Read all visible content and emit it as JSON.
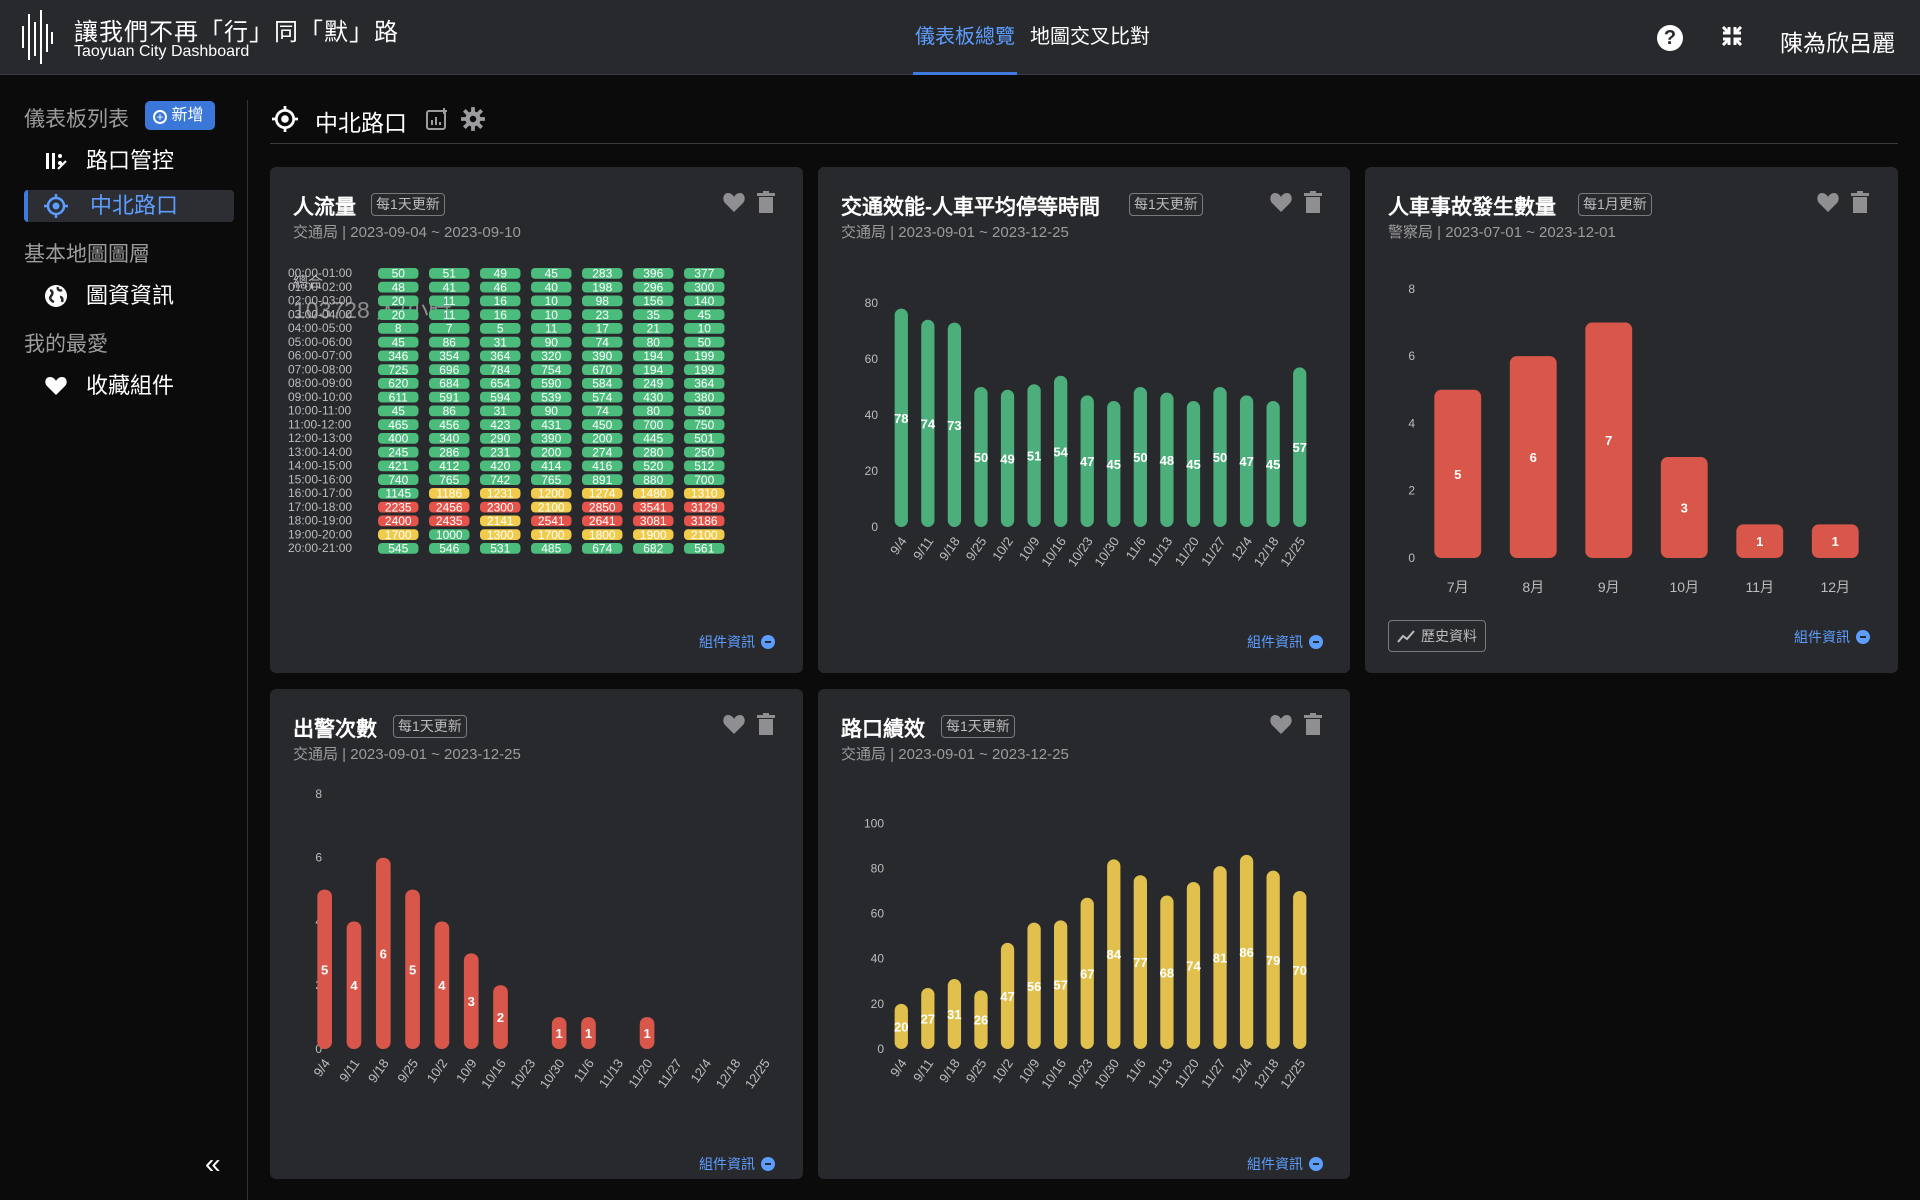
{
  "app": {
    "title": "讓我們不再「行」同「默」路",
    "subtitle": "Taoyuan City Dashboard",
    "nav": [
      "儀表板總覽",
      "地圖交叉比對"
    ],
    "user": "陳為欣呂麗",
    "icons": {
      "logo": "city-logo-icon",
      "help": "help-icon",
      "collapse": "compress-icon"
    },
    "accent": "#3f7ae0"
  },
  "sidebar": {
    "sections": {
      "dashboards": "儀表板列表",
      "basemap": "基本地圖圖層",
      "favorites": "我的最愛"
    },
    "add_button": "新增",
    "items": [
      {
        "label": "路口管控",
        "icon": "traffic-control-icon"
      },
      {
        "label": "中北路口",
        "icon": "target-icon",
        "active": true
      },
      {
        "label": "圖資資訊",
        "icon": "globe-icon"
      },
      {
        "label": "收藏組件",
        "icon": "heart-icon"
      }
    ],
    "collapse_label": "«"
  },
  "main": {
    "title": "中北路口"
  },
  "info_label": "組件資訊",
  "cards": {
    "pedestrian": {
      "title": "人流量",
      "badge": "每1天更新",
      "source": "交通局 | 2023-09-04 ~ 2023-09-10",
      "total_label": "總合",
      "total_value": "103728 人/小時"
    },
    "waiting": {
      "title": "交通效能-人車平均停等時間",
      "badge": "每1天更新",
      "source": "交通局 | 2023-09-01 ~ 2023-12-25"
    },
    "accidents": {
      "title": "人車事故發生數量",
      "badge": "每1月更新",
      "source": "警察局 | 2023-07-01 ~ 2023-12-01",
      "history_button": "歷史資料"
    },
    "dispatch": {
      "title": "出警次數",
      "badge": "每1天更新",
      "source": "交通局 | 2023-09-01 ~ 2023-12-25"
    },
    "performance": {
      "title": "路口績效",
      "badge": "每1天更新",
      "source": "交通局 | 2023-09-01 ~ 2023-12-25"
    }
  },
  "chart_data": [
    {
      "id": "pedestrian-heatmap",
      "type": "heatmap",
      "rows": [
        "00:00-01:00",
        "01:00-02:00",
        "02:00-03:00",
        "03:00-04:00",
        "04:00-05:00",
        "05:00-06:00",
        "06:00-07:00",
        "07:00-08:00",
        "08:00-09:00",
        "09:00-10:00",
        "10:00-11:00",
        "11:00-12:00",
        "12:00-13:00",
        "13:00-14:00",
        "14:00-15:00",
        "15:00-16:00",
        "16:00-17:00",
        "17:00-18:00",
        "18:00-19:00",
        "19:00-20:00",
        "20:00-21:00"
      ],
      "values": [
        [
          50,
          51,
          49,
          45,
          283,
          396,
          377
        ],
        [
          48,
          41,
          46,
          40,
          198,
          296,
          300
        ],
        [
          20,
          11,
          16,
          10,
          98,
          156,
          140
        ],
        [
          20,
          11,
          16,
          10,
          23,
          35,
          45
        ],
        [
          8,
          7,
          5,
          11,
          17,
          21,
          10
        ],
        [
          45,
          86,
          31,
          90,
          74,
          80,
          50
        ],
        [
          346,
          354,
          364,
          320,
          390,
          194,
          199
        ],
        [
          725,
          696,
          784,
          754,
          670,
          194,
          199
        ],
        [
          620,
          684,
          654,
          590,
          584,
          249,
          364
        ],
        [
          611,
          591,
          594,
          539,
          574,
          430,
          380
        ],
        [
          45,
          86,
          31,
          90,
          74,
          80,
          50
        ],
        [
          465,
          456,
          423,
          431,
          450,
          700,
          750
        ],
        [
          400,
          340,
          290,
          390,
          200,
          445,
          501
        ],
        [
          245,
          286,
          231,
          200,
          274,
          280,
          250
        ],
        [
          421,
          412,
          420,
          414,
          416,
          520,
          512
        ],
        [
          740,
          765,
          742,
          765,
          891,
          880,
          700
        ],
        [
          1145,
          1186,
          1231,
          1200,
          1274,
          1480,
          1310
        ],
        [
          2235,
          2456,
          2300,
          2100,
          2850,
          3541,
          3129
        ],
        [
          2400,
          2435,
          2141,
          2541,
          2641,
          3081,
          3186
        ],
        [
          1700,
          1000,
          1300,
          1700,
          1800,
          1900,
          2100
        ],
        [
          545,
          546,
          531,
          485,
          674,
          682,
          561
        ]
      ],
      "colors": {
        "low": "#4cbc7c",
        "mid": "#f1cb4c",
        "high": "#e5534a"
      }
    },
    {
      "id": "waiting-bar",
      "type": "bar",
      "categories": [
        "9/4",
        "9/11",
        "9/18",
        "9/25",
        "10/2",
        "10/9",
        "10/16",
        "10/23",
        "10/30",
        "11/6",
        "11/13",
        "11/20",
        "11/27",
        "12/4",
        "12/18",
        "12/25"
      ],
      "values": [
        78,
        74,
        73,
        50,
        49,
        51,
        54,
        47,
        45,
        50,
        48,
        45,
        50,
        47,
        45,
        57
      ],
      "ylim": [
        0,
        85
      ],
      "yticks": [
        0,
        20,
        40,
        60,
        80
      ],
      "color": "#4cae7b"
    },
    {
      "id": "accidents-bar",
      "type": "bar",
      "categories": [
        "7月",
        "8月",
        "9月",
        "10月",
        "11月",
        "12月"
      ],
      "values": [
        5,
        6,
        7,
        3,
        1,
        1
      ],
      "ylim": [
        0,
        8.5
      ],
      "yticks": [
        0,
        2,
        4,
        6,
        8
      ],
      "color": "#d9574a"
    },
    {
      "id": "dispatch-bar",
      "type": "bar",
      "categories": [
        "9/4",
        "9/11",
        "9/18",
        "9/25",
        "10/2",
        "10/9",
        "10/16",
        "10/23",
        "10/30",
        "11/6",
        "11/13",
        "11/20",
        "11/27",
        "12/4",
        "12/18",
        "12/25"
      ],
      "values": [
        5,
        4,
        6,
        5,
        4,
        3,
        2,
        0,
        1,
        1,
        0,
        1,
        0,
        0,
        0,
        0
      ],
      "ylim": [
        0,
        8.5
      ],
      "yticks": [
        0,
        2,
        4,
        6,
        8
      ],
      "color": "#d9574a"
    },
    {
      "id": "performance-bar",
      "type": "bar",
      "categories": [
        "9/4",
        "9/11",
        "9/18",
        "9/25",
        "10/2",
        "10/9",
        "10/16",
        "10/23",
        "10/30",
        "11/6",
        "11/13",
        "11/20",
        "11/27",
        "12/4",
        "12/18",
        "12/25"
      ],
      "values": [
        20,
        27,
        31,
        26,
        47,
        56,
        57,
        67,
        84,
        77,
        68,
        74,
        81,
        86,
        79,
        70
      ],
      "ylim": [
        0,
        105
      ],
      "yticks": [
        0,
        20,
        40,
        60,
        80,
        100
      ],
      "color": "#e1c04e"
    }
  ]
}
